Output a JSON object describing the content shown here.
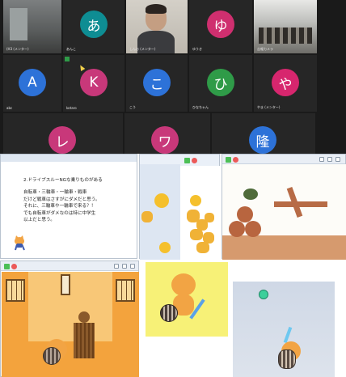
{
  "participants": [
    {
      "name": "(H3 (メンター)",
      "photo": true
    },
    {
      "name": "あんこ",
      "initial": "あ",
      "color": "#0e8d93"
    },
    {
      "name": "しんお (メンター)",
      "photo": true
    },
    {
      "name": "ゆうき",
      "initial": "ゆ",
      "color": "#cf2f6f"
    },
    {
      "name": "吉報カメラ",
      "photo": true
    },
    {
      "name": "abc",
      "initial": "A",
      "color": "#2d72d8"
    },
    {
      "name": "kotaro",
      "initial": "K",
      "color": "#c8387a"
    },
    {
      "name": "こう",
      "initial": "こ",
      "color": "#2d72d8"
    },
    {
      "name": "ひなちゃん",
      "initial": "ひ",
      "color": "#2f9b48"
    },
    {
      "name": "やま (メンター)",
      "initial": "や",
      "color": "#d7266e"
    },
    {
      "name": "",
      "initial": "レ",
      "color": "#c8387a"
    },
    {
      "name": "",
      "initial": "ワ",
      "color": "#c8387a"
    },
    {
      "name": "",
      "initial": "隆",
      "color": "#2d72d8"
    }
  ],
  "slide": {
    "heading": "2.ドライブスルーNGな乗りものがある",
    "lines": [
      "自転車・三輪車・一輪車・戦車",
      "だけど戦車はさすがにダメだと思う。",
      "それに、三輪車や一輪車で来る？！",
      "でも自転車がダメなのは特に中学生",
      "以上だと思う。"
    ]
  },
  "colors": {
    "zoom_bg": "#1a1a1a",
    "tile_bg": "#262626",
    "stage_orange": "#f5a64b",
    "flag_green": "#4cbf56",
    "stop_red": "#ec5959"
  }
}
